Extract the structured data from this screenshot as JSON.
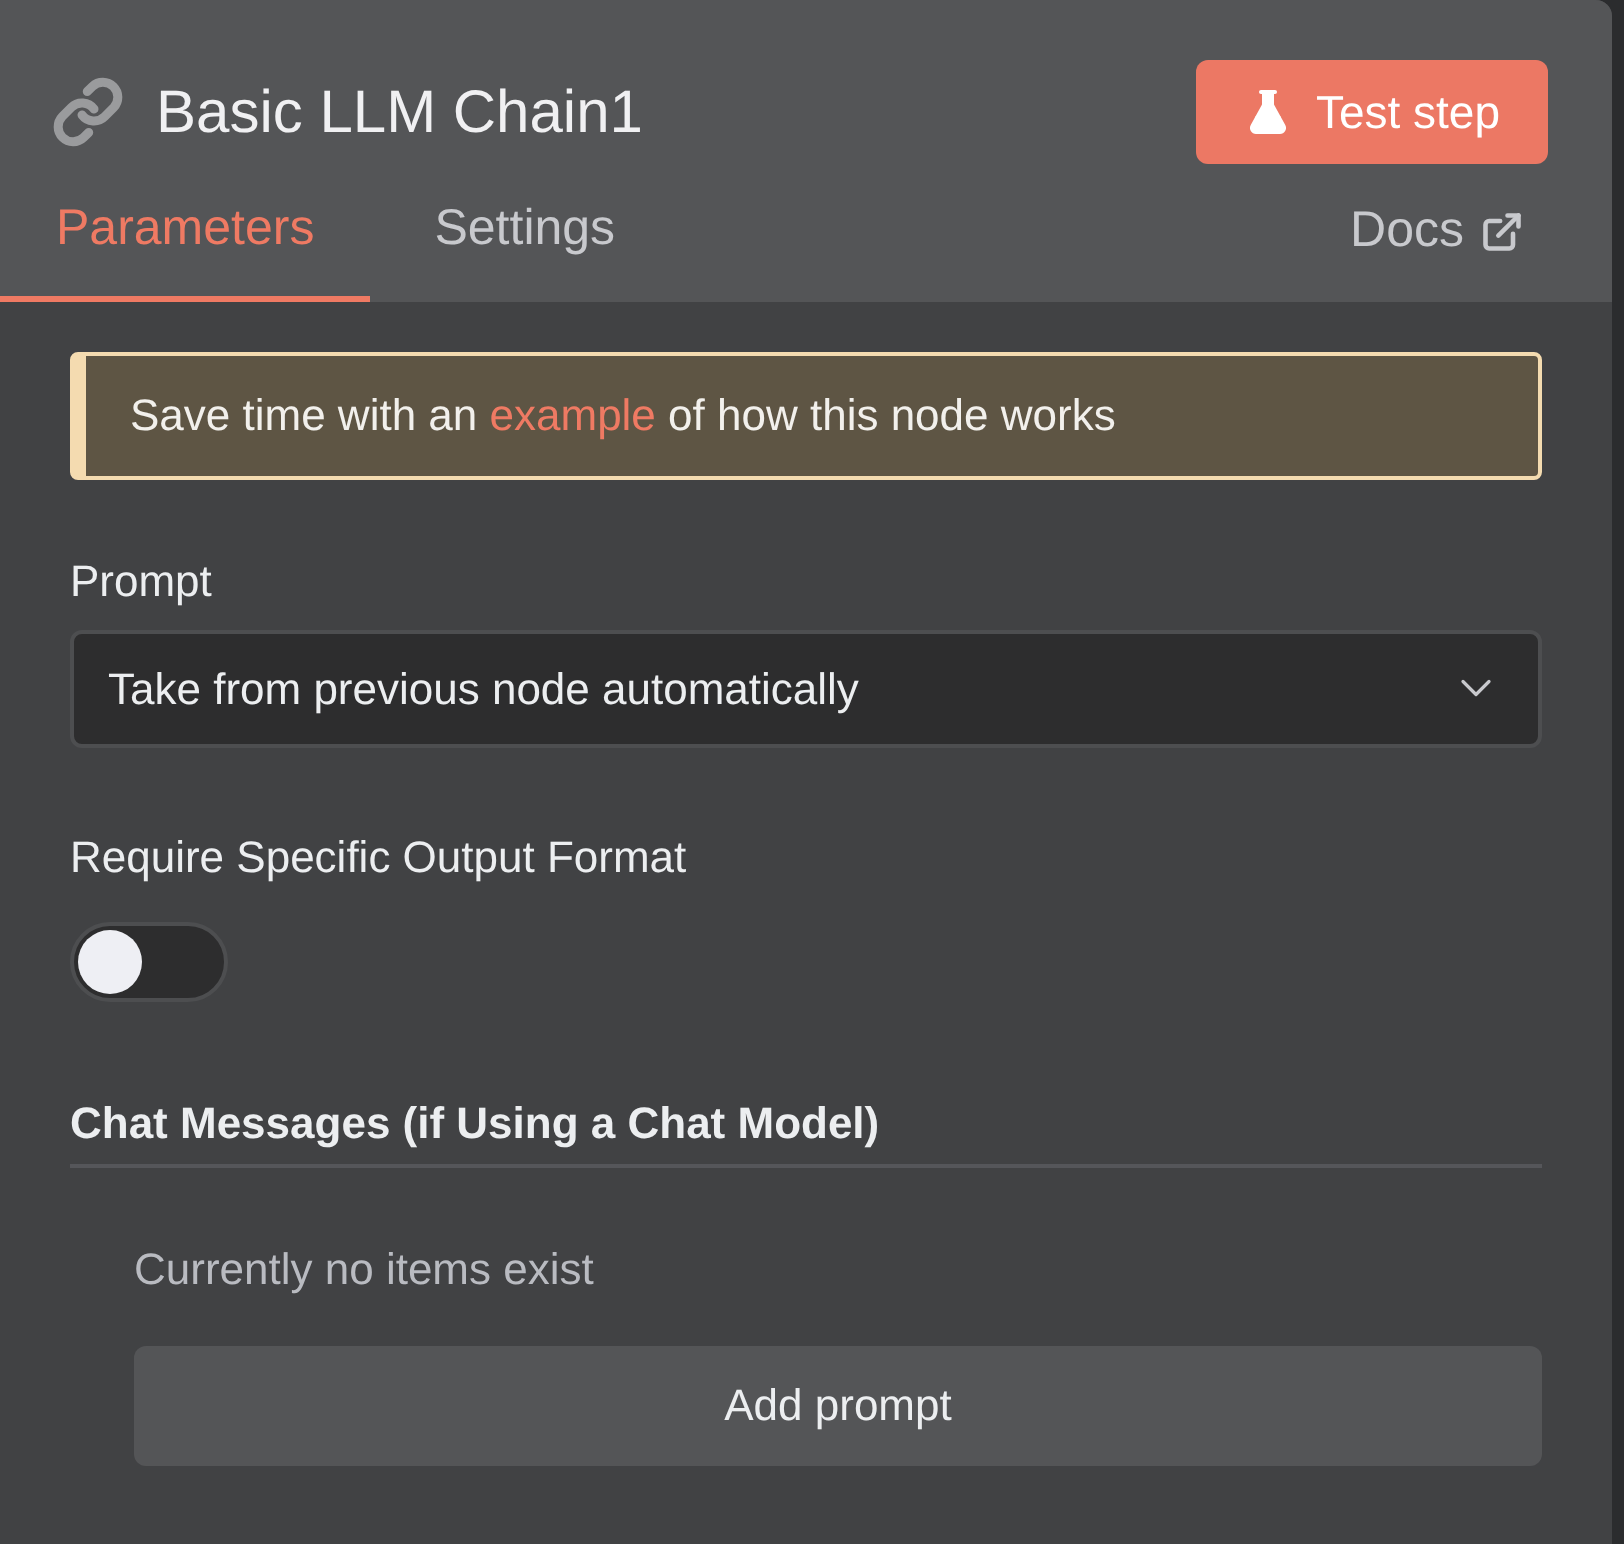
{
  "node": {
    "title": "Basic LLM Chain1",
    "test_button": "Test step"
  },
  "tabs": [
    {
      "label": "Parameters",
      "selected": true
    },
    {
      "label": "Settings",
      "selected": false
    }
  ],
  "docs_link": "Docs",
  "callout": {
    "before": "Save time with an",
    "link": "example",
    "after": "of how this node works"
  },
  "prompt": {
    "label": "Prompt",
    "value": "Take from previous node automatically"
  },
  "output_format": {
    "label": "Require Specific Output Format",
    "on": false
  },
  "chat_messages": {
    "heading": "Chat Messages (if Using a Chat Model)",
    "empty_text": "Currently no items exist",
    "add_button": "Add prompt"
  }
}
